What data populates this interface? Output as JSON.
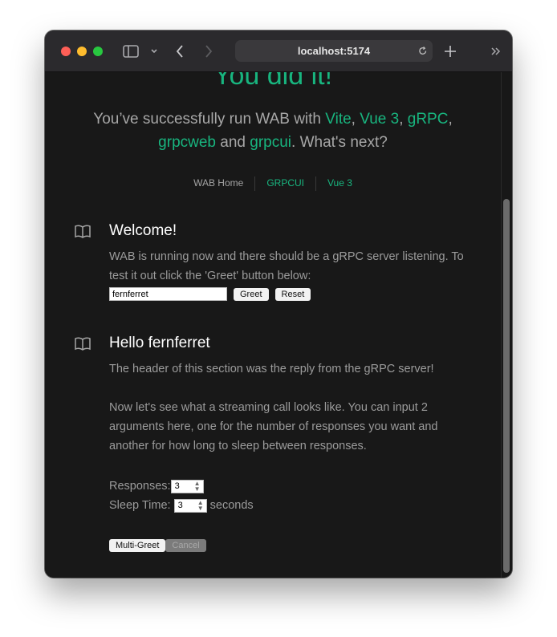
{
  "browser": {
    "url": "localhost:5174"
  },
  "hero": {
    "title": "You did it!",
    "sub_prefix": "You’ve successfully run WAB with ",
    "link_vite": "Vite",
    "link_vue": "Vue 3",
    "link_grpc": "gRPC",
    "link_grpcweb": "grpcweb",
    "link_grpcui": "grpcui",
    "sep_comma": ", ",
    "and_text": " and ",
    "sub_suffix": ". What's next?"
  },
  "nav": {
    "items": [
      "WAB Home",
      "GRPCUI",
      "Vue 3"
    ]
  },
  "welcome": {
    "title": "Welcome!",
    "body": "WAB is running now and there should be a gRPC server listening. To test it out click the 'Greet' button below:",
    "input_value": "fernferret",
    "greet_label": "Greet",
    "reset_label": "Reset"
  },
  "hello": {
    "title": "Hello fernferret",
    "reply_text": "The header of this section was the reply from the gRPC server!",
    "stream_text": "Now let's see what a streaming call looks like. You can input 2 arguments here, one for the number of responses you want and another for how long to sleep between responses.",
    "responses_label": "Responses:",
    "responses_value": "3",
    "sleep_label": "Sleep Time:",
    "sleep_value": "3",
    "seconds_label": "seconds",
    "multi_greet_label": "Multi-Greet",
    "cancel_label": "Cancel"
  },
  "colors": {
    "accent": "#18b57f",
    "background": "#181818"
  }
}
